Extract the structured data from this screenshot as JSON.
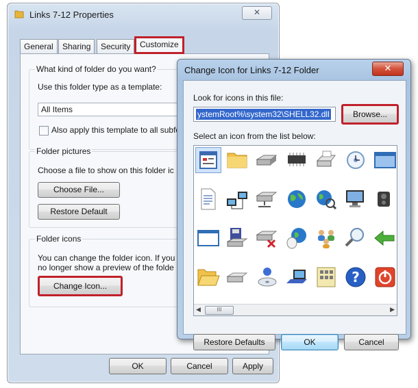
{
  "properties_dialog": {
    "title": "Links 7-12 Properties",
    "close_glyph": "✕",
    "tabs": [
      "General",
      "Sharing",
      "Security",
      "Customize"
    ],
    "active_tab": "Customize",
    "folder_type": {
      "question": "What kind of folder do you want?",
      "template_label": "Use this folder type as a template:",
      "template_value": "All Items",
      "apply_subfolders": "Also apply this template to all subfo"
    },
    "folder_pictures": {
      "legend": "Folder pictures",
      "description": "Choose a file to show on this folder ic",
      "choose_file": "Choose File...",
      "restore_default": "Restore Default"
    },
    "folder_icons": {
      "legend": "Folder icons",
      "line1": "You can change the folder icon. If you",
      "line2": "no longer show a preview of the folde",
      "change_icon": "Change Icon..."
    },
    "footer": {
      "ok": "OK",
      "cancel": "Cancel",
      "apply": "Apply"
    }
  },
  "change_icon_dialog": {
    "title": "Change Icon for Links 7-12 Folder",
    "close_glyph": "✕",
    "look_label": "Look for icons in this file:",
    "path_value": "ystemRoot%\\system32\\SHELL32.dll",
    "browse": "Browse...",
    "select_label": "Select an icon from the list below:",
    "scroll_thumb": "III",
    "icons": [
      [
        "document-window-icon",
        "folder-icon",
        "disk-drive-icon",
        "chip-icon",
        "printer-icon",
        "clock-cd-icon",
        "window-icon"
      ],
      [
        "text-document-icon",
        "network-computers-icon",
        "network-drive-icon",
        "globe-icon",
        "globe-search-icon",
        "monitor-icon",
        "speaker-icon"
      ],
      [
        "empty-window-icon",
        "save-drive-icon",
        "network-drive-disconnected-icon",
        "mouse-globe-icon",
        "users-network-icon",
        "magnifier-icon",
        "green-arrow-icon"
      ],
      [
        "folder-open-icon",
        "removable-drive-icon",
        "user-cd-icon",
        "monitor-desk-icon",
        "control-panel-icon",
        "help-icon",
        "power-icon"
      ]
    ],
    "restore_defaults": "Restore Defaults",
    "ok": "OK",
    "cancel": "Cancel"
  },
  "colors": {
    "highlight_red": "#c0202a",
    "selection_blue": "#3367cc"
  }
}
